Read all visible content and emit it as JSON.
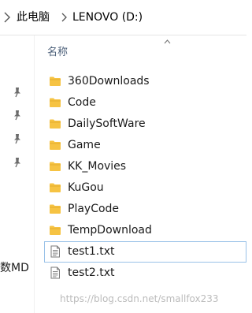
{
  "address_bar": {
    "crumbs": [
      "此电脑",
      "LENOVO (D:)"
    ]
  },
  "nav_pane": {
    "pinned_count": 4,
    "clipped_label": "数MD"
  },
  "file_list": {
    "column_header": "名称",
    "items": [
      {
        "name": "360Downloads",
        "type": "folder"
      },
      {
        "name": "Code",
        "type": "folder"
      },
      {
        "name": "DailySoftWare",
        "type": "folder"
      },
      {
        "name": "Game",
        "type": "folder"
      },
      {
        "name": "KK_Movies",
        "type": "folder"
      },
      {
        "name": "KuGou",
        "type": "folder"
      },
      {
        "name": "PlayCode",
        "type": "folder"
      },
      {
        "name": "TempDownload",
        "type": "folder"
      },
      {
        "name": "test1.txt",
        "type": "text-file",
        "selected": true
      },
      {
        "name": "test2.txt",
        "type": "text-file"
      }
    ]
  },
  "watermark": "https://blog.csdn.net/smallfox233",
  "colors": {
    "folder": "#f6c343",
    "selection_border": "#99c2e8",
    "header_text": "#4c607a"
  }
}
